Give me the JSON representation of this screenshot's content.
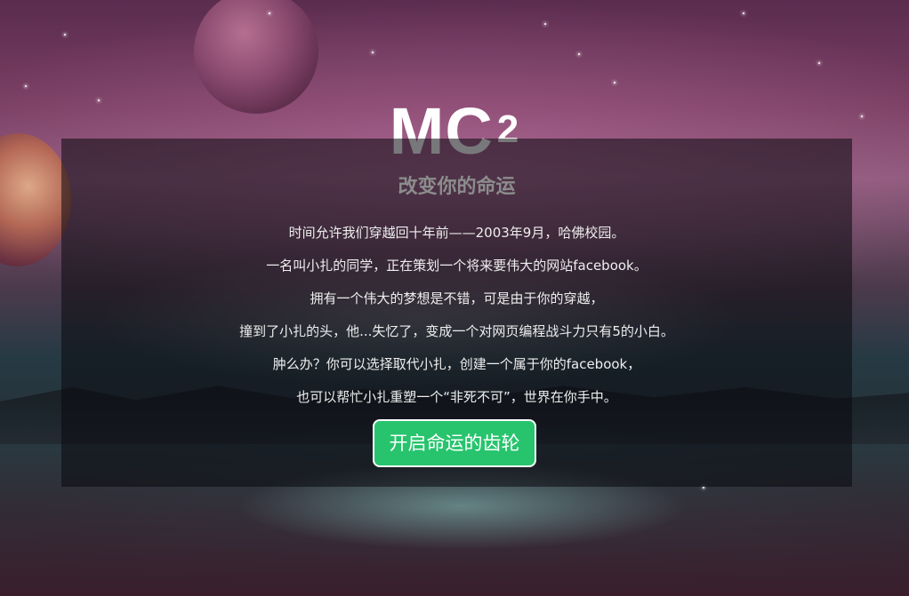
{
  "brand": {
    "logo_text": "MC",
    "logo_superscript": "2"
  },
  "panel": {
    "title": "改变你的命运",
    "paragraphs": [
      "时间允许我们穿越回十年前——2003年9月，哈佛校园。",
      "一名叫小扎的同学，正在策划一个将来要伟大的网站facebook。",
      "拥有一个伟大的梦想是不错，可是由于你的穿越，",
      "撞到了小扎的头，他...失忆了，变成一个对网页编程战斗力只有5的小白。",
      "肿么办？你可以选择取代小扎，创建一个属于你的facebook，",
      "也可以帮忙小扎重塑一个“非死不可”，世界在你手中。"
    ],
    "cta_label": "开启命运的齿轮"
  },
  "colors": {
    "cta_background": "#27c46d",
    "panel_overlay": "rgba(10,10,14,0.55)",
    "title_color": "#8c8c8c"
  }
}
